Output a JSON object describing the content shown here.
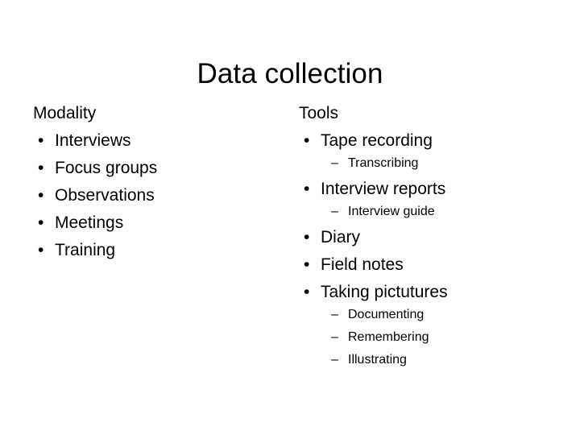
{
  "slide": {
    "title": "Data collection",
    "columns": [
      {
        "id": "modality",
        "heading": "Modality",
        "items": [
          {
            "bullet": "•",
            "label": "Interviews",
            "sub": []
          },
          {
            "bullet": "•",
            "label": "Focus groups",
            "sub": []
          },
          {
            "bullet": "•",
            "label": "Observations",
            "sub": []
          },
          {
            "bullet": "•",
            "label": "Meetings",
            "sub": []
          },
          {
            "bullet": "•",
            "label": "Training",
            "sub": []
          }
        ]
      },
      {
        "id": "tools",
        "heading": "Tools",
        "items": [
          {
            "bullet": "•",
            "label": "Tape recording",
            "sub": [
              {
                "dash": "–",
                "label": "Transcribing"
              }
            ]
          },
          {
            "bullet": "•",
            "label": "Interview reports",
            "sub": [
              {
                "dash": "–",
                "label": "Interview guide"
              }
            ]
          },
          {
            "bullet": "•",
            "label": "Diary",
            "sub": []
          },
          {
            "bullet": "•",
            "label": "Field notes",
            "sub": []
          },
          {
            "bullet": "•",
            "label": "Taking pictutures",
            "sub": [
              {
                "dash": "–",
                "label": "Documenting"
              },
              {
                "dash": "–",
                "label": "Remembering"
              },
              {
                "dash": "–",
                "label": "Illustrating"
              }
            ]
          }
        ]
      }
    ],
    "colors": {
      "background": "#ffffff",
      "text": "#000000"
    }
  }
}
